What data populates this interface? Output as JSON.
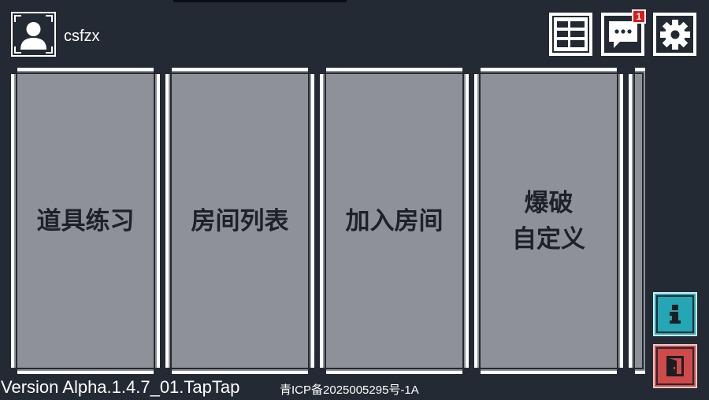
{
  "user": {
    "name": "csfzx"
  },
  "toolbar": {
    "grid_icon": "grid-icon",
    "messages_icon": "chat-icon",
    "messages_badge": "1",
    "settings_icon": "gear-icon"
  },
  "modes": [
    {
      "label": "道具练习"
    },
    {
      "label": "房间列表"
    },
    {
      "label": "加入房间"
    },
    {
      "label": "爆破\n自定义"
    }
  ],
  "side": {
    "info_icon": "info-icon",
    "exit_icon": "exit-door-icon"
  },
  "footer": {
    "version": "Version Alpha.1.4.7_01.TapTap",
    "icp": "青ICP备2025005295号-1A"
  },
  "colors": {
    "background": "#232a33",
    "card": "#8e9197",
    "badge": "#e01818",
    "info": "#25a6b4",
    "exit": "#cf4a48"
  }
}
